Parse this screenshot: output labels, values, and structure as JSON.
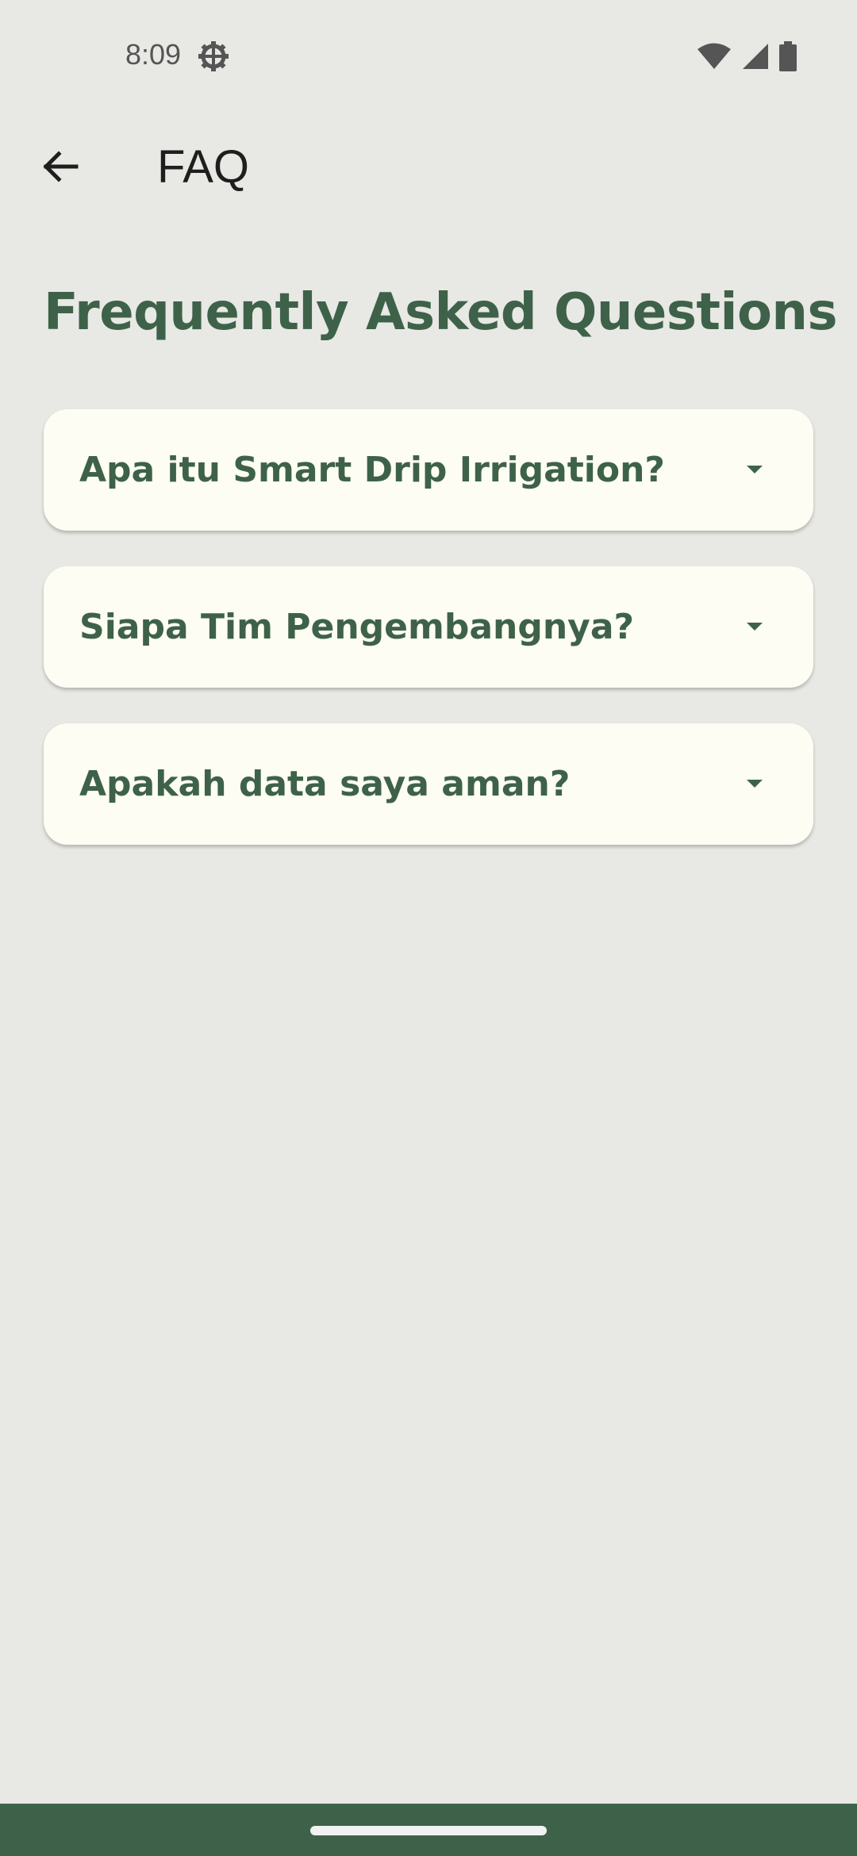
{
  "status_bar": {
    "time": "8:09",
    "icons": [
      "settings-icon",
      "wifi-icon",
      "signal-icon",
      "battery-icon"
    ]
  },
  "app_bar": {
    "back_icon": "arrow-back-icon",
    "title": "FAQ"
  },
  "main": {
    "heading": "Frequently Asked Questions",
    "faq_items": [
      {
        "question": "Apa itu Smart Drip Irrigation?",
        "icon": "caret-down-icon",
        "expanded": false
      },
      {
        "question": "Siapa Tim Pengembangnya?",
        "icon": "caret-down-icon",
        "expanded": false
      },
      {
        "question": "Apakah data saya aman?",
        "icon": "caret-down-icon",
        "expanded": false
      }
    ]
  },
  "colors": {
    "background": "#e8e8e4",
    "accent": "#3e6249",
    "card": "#fdfdf3",
    "text_dark": "#1e1e1e"
  }
}
